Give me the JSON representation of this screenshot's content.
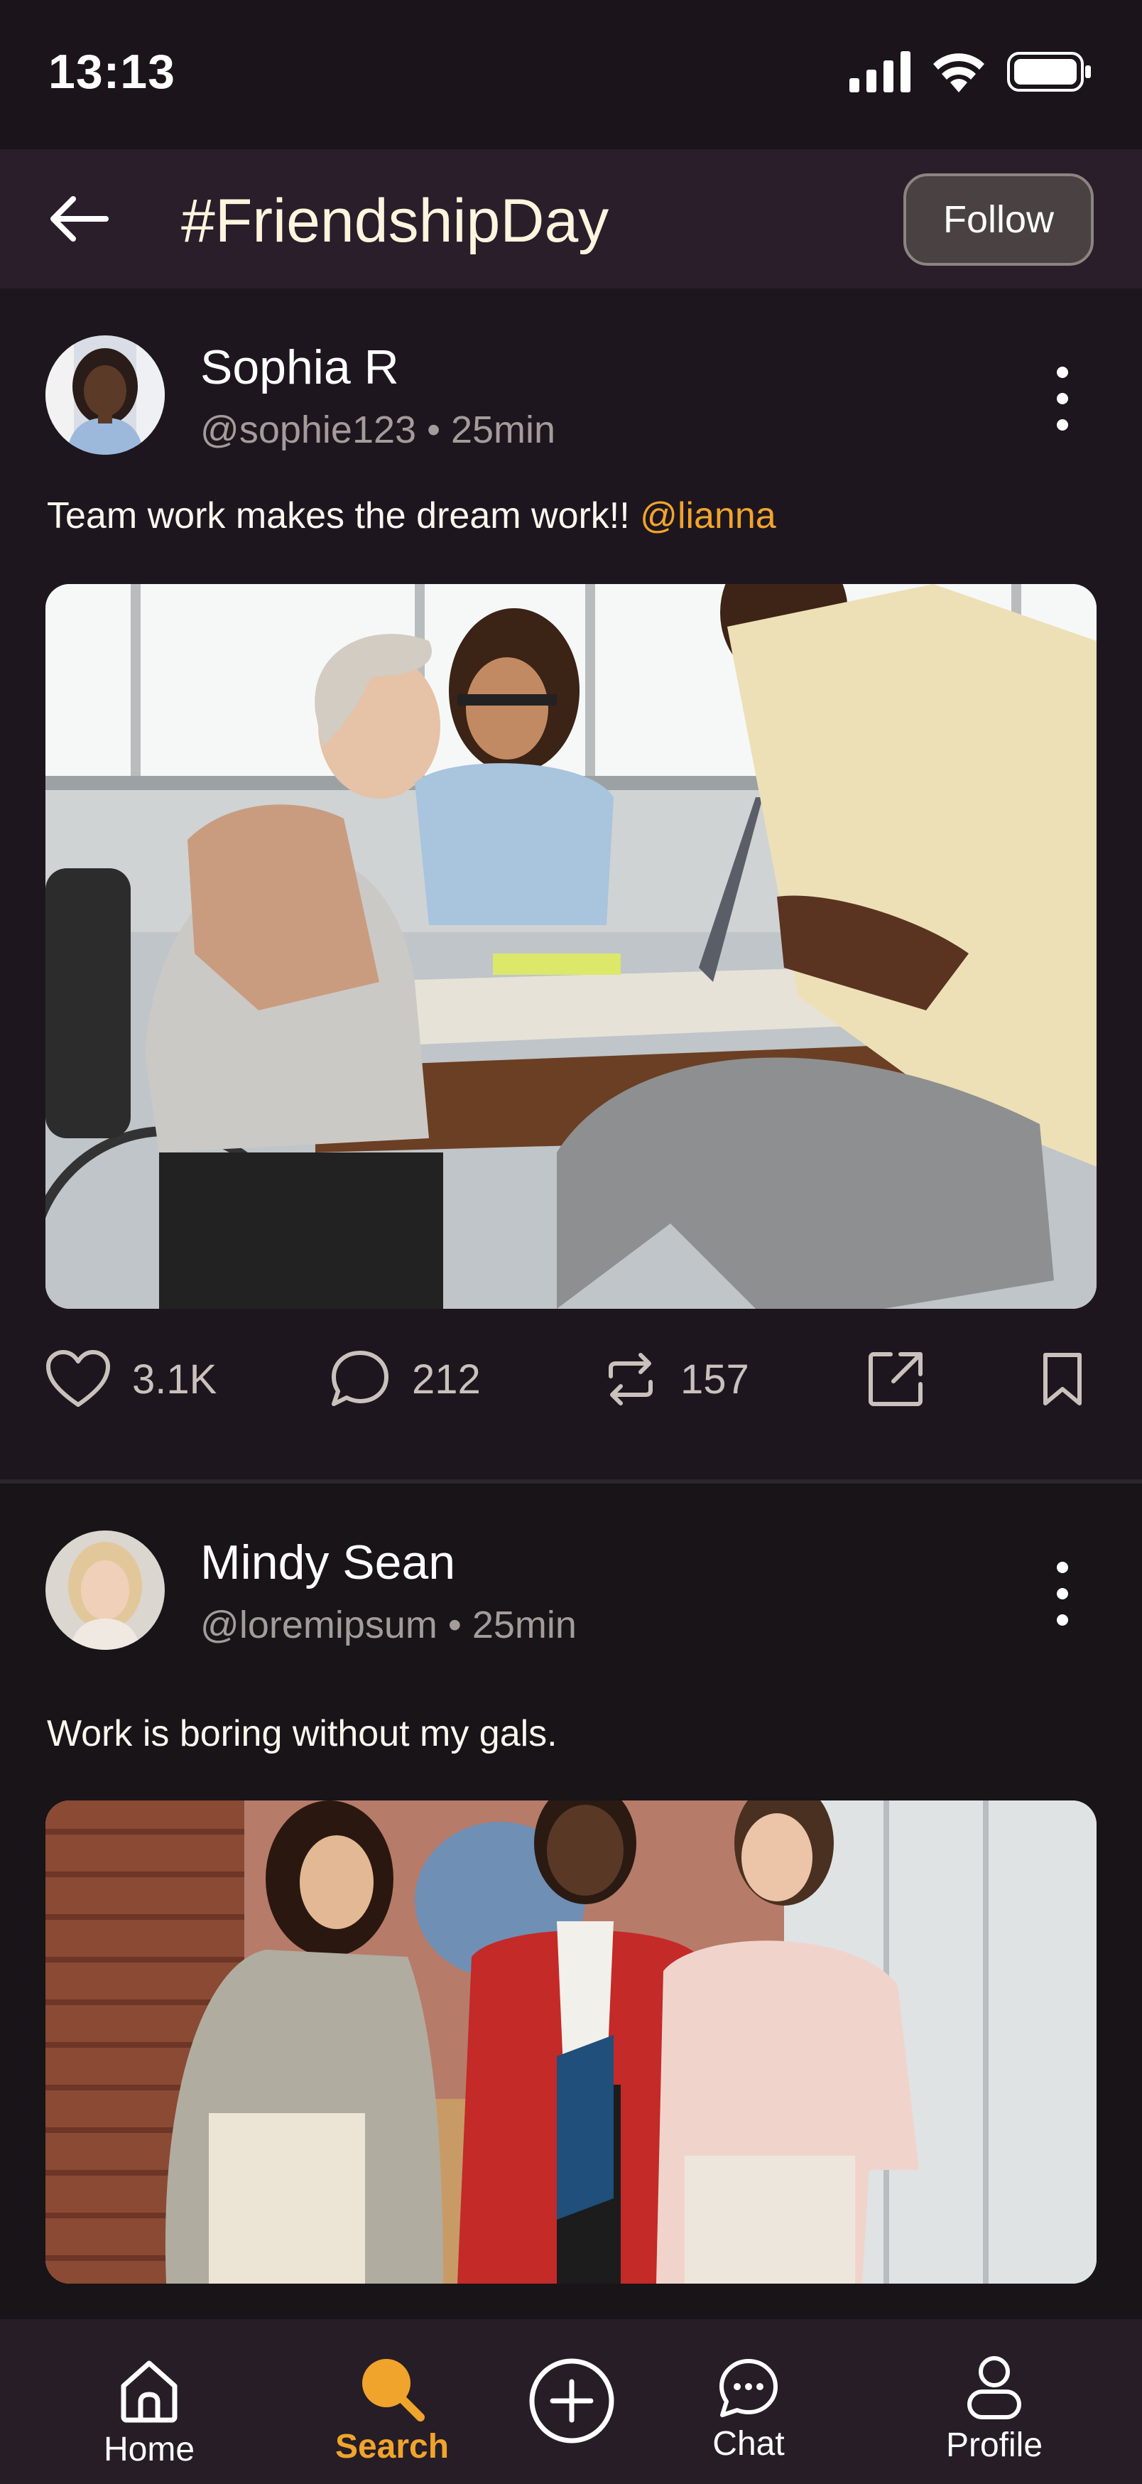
{
  "status_bar": {
    "time": "13:13"
  },
  "header": {
    "title": "#FriendshipDay",
    "follow_label": "Follow"
  },
  "posts": [
    {
      "name": "Sophia R",
      "handle": "@sophie123",
      "time": "25min",
      "text": "Team work makes the dream work!! ",
      "mention": "@lianna",
      "likes": "3.1K",
      "comments": "212",
      "reposts": "157"
    },
    {
      "name": "Mindy Sean",
      "handle": "@loremipsum",
      "time": "25min",
      "text": "Work is boring without my gals."
    }
  ],
  "nav": {
    "items": [
      {
        "label": "Home",
        "icon": "home-icon"
      },
      {
        "label": "Search",
        "icon": "search-icon",
        "active": true
      },
      {
        "label": "",
        "icon": "plus-circle-icon"
      },
      {
        "label": "Chat",
        "icon": "chat-icon"
      },
      {
        "label": "Profile",
        "icon": "profile-icon"
      }
    ]
  },
  "colors": {
    "accent": "#f0a42c",
    "background": "#1e161e",
    "header": "#291e29"
  }
}
